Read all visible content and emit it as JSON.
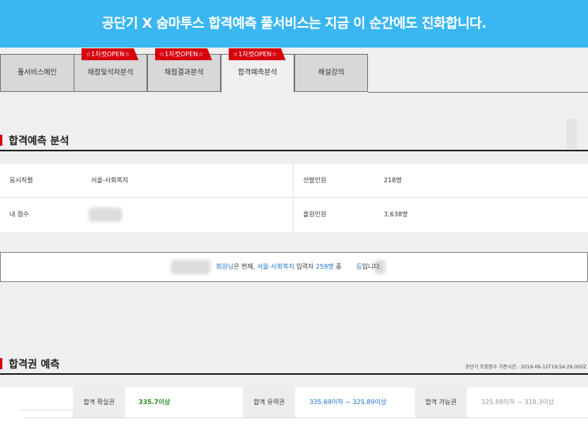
{
  "banner": {
    "text": "공단기 X 숨마투스 합격예측 풀서비스는 지금 이 순간에도 진화합니다."
  },
  "tabs": [
    {
      "label": "풀서비스메인",
      "badge": ""
    },
    {
      "label": "채점및석차분석",
      "badge": "☆1차컷OPEN☆"
    },
    {
      "label": "채점결과분석",
      "badge": "☆1차컷OPEN☆"
    },
    {
      "label": "합격예측분석",
      "badge": "☆1차컷OPEN☆"
    },
    {
      "label": "해설강의",
      "badge": ""
    }
  ],
  "section1": {
    "title": "합격예측 분석"
  },
  "info": {
    "field_label": "응시직렬",
    "field_value": "서울-사회복지",
    "score_label": "내 점수",
    "score_value": "",
    "selected_label": "선발인원",
    "selected_value": "218명",
    "applicants_label": "출원인원",
    "applicants_value": "3,638명"
  },
  "notice": {
    "pre": "회원님",
    "text1": "은 현재, ",
    "series": "서울-사회복지",
    "text2": " 입력자 ",
    "count": "259명",
    "text3": " 중 ",
    "rank_suffix": "등",
    "text4": "입니다."
  },
  "section2": {
    "title": "합격권 예측",
    "meta": "공단기 조정점수 기준시간 : 2019-06-15T19:54:29.000Z"
  },
  "prediction": {
    "certain_label": "합격 확실권",
    "certain_value": "335.7이상",
    "likely_label": "합격 유력권",
    "likely_value": "335.69이하 ~ 325.89이상",
    "possible_label": "합격 가능권",
    "possible_value": "325.88이하 ~ 318.3이상"
  },
  "colors": {
    "banner": "#3ab7f0",
    "badge": "#d6000d",
    "certain": "#2a8a2a",
    "likely": "#1a6fd0",
    "possible": "#999999"
  }
}
